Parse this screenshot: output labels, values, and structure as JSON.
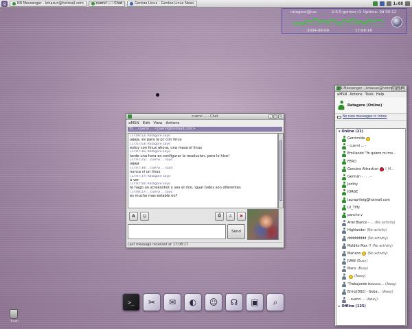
{
  "top_panel": {
    "launcher_icon": "gentoo-icon",
    "tasks": [
      {
        "label": "KN Messenger - kmasun@hotmail.com",
        "active": false
      },
      {
        "label": "cuervi ... - Chat",
        "active": true
      },
      {
        "label": "Gentoo Linux - Gentoo Linux News",
        "active": false
      }
    ],
    "clock": "1:08"
  },
  "sysmon": {
    "user_host": "ratagore@tux",
    "kernel": "2.6.5-gentoo-r1",
    "uptime": "Uptime: 0d 00:12",
    "date": "2004-06-09",
    "time": "17:08:18",
    "graph_color": "#2bd12b"
  },
  "chat": {
    "title": "cuervi ... - Chat",
    "menu": [
      "aMSN",
      "Edit",
      "View",
      "Actions"
    ],
    "to_line": "To: ...cuervi ... <cuervi@hotmail.com>",
    "messages": [
      {
        "header": "[17:06:52] Ratagore says:",
        "text": "jajaja, es para la pc con linux"
      },
      {
        "header": "[17:07:03] Ratagore says:",
        "text": "estoy con linux ahora, una masa el linux"
      },
      {
        "header": "[17:07:16] Ratagore says:",
        "text": "tarde una hora en configurar la resolucion, pero lo hice!"
      },
      {
        "header": "[17:07:25] ...cuervi ... says:",
        "text": "jajaja"
      },
      {
        "header": "[17:07:30] ...cuervi ... says:",
        "text": "nunca vi un linux"
      },
      {
        "header": "[17:07:37] Ratagore says:",
        "text": "a ver"
      },
      {
        "header": "[17:07:50] Ratagore says:",
        "text": "te hago un screenshot y ves el mio, igual todos son diferentes"
      },
      {
        "header": "[17:08:17] ...cuervi ... says:",
        "text": "es mucho mas estable no?"
      }
    ],
    "format_buttons": [
      "font-icon",
      "smiley-icon"
    ],
    "right_buttons": [
      "send-file-icon",
      "invite-icon",
      "block-icon"
    ],
    "send_label": "Send",
    "status": "Last message received at 17:08:17"
  },
  "contacts": {
    "title": "KN Messenger - kmasun@hotmail.com",
    "menu": [
      "aMSN",
      "Actions",
      "Tools",
      "Help"
    ],
    "me": "Ratagore (Online)",
    "mail_text": "No new messages in Inbox",
    "online_header": "Online (22)",
    "offline_header": "Offline (125)",
    "online": [
      {
        "name": "Gerrómida",
        "emoticon": "smiley",
        "status": "",
        "state": "online"
      },
      {
        "name": "- cuervi ... -",
        "emoticon": "",
        "status": "",
        "state": "online"
      },
      {
        "name": "Emiliando \"Yo quiero mi mo...",
        "emoticon": "",
        "status": "",
        "state": "online"
      },
      {
        "name": "FERO",
        "emoticon": "",
        "status": "",
        "state": "online"
      },
      {
        "name": "Genuine Attraction",
        "emoticon": "heart",
        "status": "I_M...",
        "state": "online"
      },
      {
        "name": "Germán - . . . -",
        "emoticon": "",
        "status": "",
        "state": "online"
      },
      {
        "name": "Jonthy",
        "emoticon": "",
        "status": "",
        "state": "online"
      },
      {
        "name": "JORGE",
        "emoticon": "",
        "status": "",
        "state": "online"
      },
      {
        "name": "lauraprileig@hotmail.com",
        "emoticon": "",
        "status": "",
        "state": "online"
      },
      {
        "name": "Lil_Tiffy",
        "emoticon": "",
        "status": "",
        "state": "online"
      },
      {
        "name": "pancho v",
        "emoticon": "",
        "status": "",
        "state": "online"
      },
      {
        "name": "Ariel Blanco - ...",
        "emoticon": "",
        "status": "(No activity)",
        "state": "away"
      },
      {
        "name": "Highlander",
        "emoticon": "",
        "status": "(No activity)",
        "state": "away"
      },
      {
        "name": "ddddddddd",
        "emoticon": "",
        "status": "(No activity)",
        "state": "away"
      },
      {
        "name": "Maldito Max !!",
        "emoticon": "",
        "status": "(No activity)",
        "state": "away"
      },
      {
        "name": "Mariano",
        "emoticon": "smiley",
        "status": "(No activity)",
        "state": "away"
      },
      {
        "name": "JUAN",
        "emoticon": "",
        "status": "(Busy)",
        "state": "away"
      },
      {
        "name": "Mans",
        "emoticon": "",
        "status": "(Busy)",
        "state": "away"
      },
      {
        "name": "",
        "emoticon": "smiley",
        "status": "(Away)",
        "state": "away"
      },
      {
        "name": "\"Trabajando buuuuu...",
        "emoticon": "",
        "status": "(Away)",
        "state": "away"
      },
      {
        "name": "Brino[D82] - Goba...",
        "emoticon": "",
        "status": "(Away)",
        "state": "away"
      },
      {
        "name": "...cuervi ...",
        "emoticon": "",
        "status": "(Away)",
        "state": "away"
      }
    ]
  },
  "dock": [
    {
      "name": "terminal-icon",
      "glyph": ">_"
    },
    {
      "name": "tools-icon",
      "glyph": "✂"
    },
    {
      "name": "mail-icon",
      "glyph": "✉"
    },
    {
      "name": "browser-icon",
      "glyph": "◐"
    },
    {
      "name": "messenger-icon",
      "glyph": "☺"
    },
    {
      "name": "headset-icon",
      "glyph": "☊"
    },
    {
      "name": "screenshot-icon",
      "glyph": "▣"
    },
    {
      "name": "search-icon",
      "glyph": "⌕"
    }
  ],
  "desktop": {
    "trash_label": "Trash"
  }
}
